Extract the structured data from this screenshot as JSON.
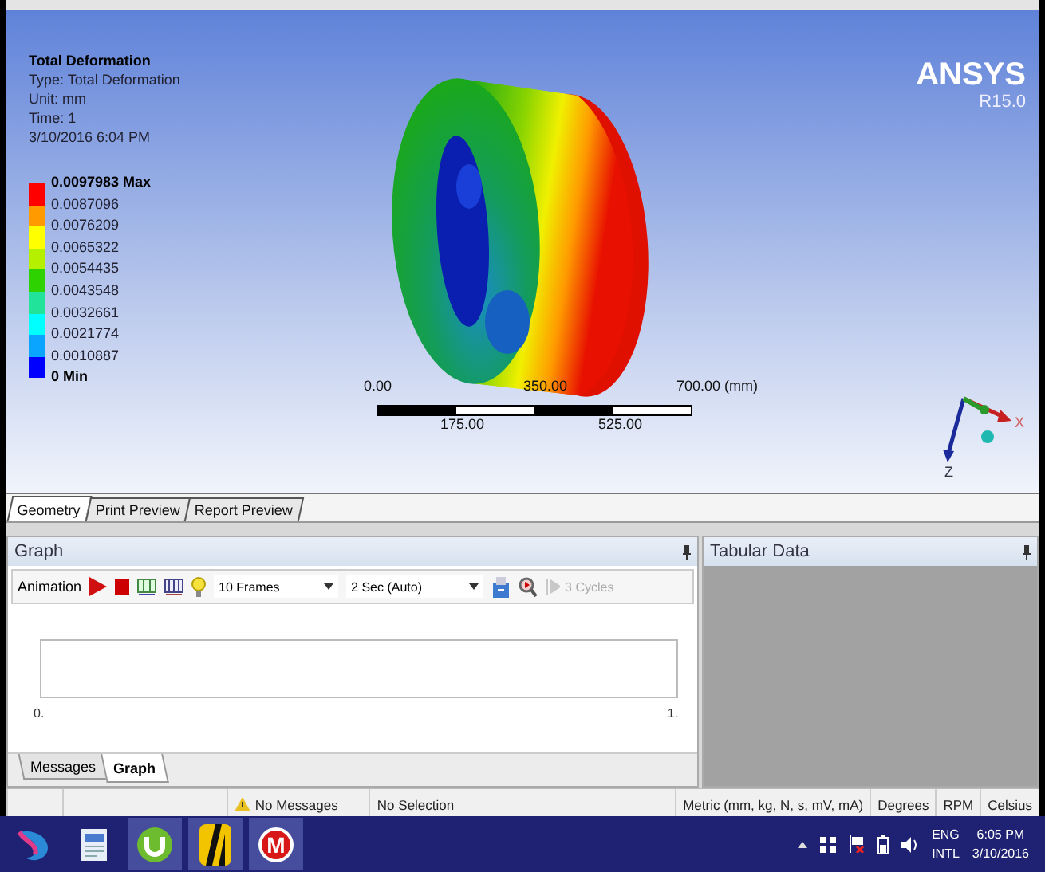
{
  "viewport": {
    "result_title": "Total Deformation",
    "details": [
      "Type: Total Deformation",
      "Unit: mm",
      "Time: 1",
      "3/10/2016 6:04 PM"
    ],
    "legend": {
      "labels": [
        {
          "text": "0.0097983 Max",
          "kind": "max"
        },
        {
          "text": "0.0087096",
          "kind": "value"
        },
        {
          "text": "0.0076209",
          "kind": "value"
        },
        {
          "text": "0.0065322",
          "kind": "value"
        },
        {
          "text": "0.0054435",
          "kind": "value"
        },
        {
          "text": "0.0043548",
          "kind": "value"
        },
        {
          "text": "0.0032661",
          "kind": "value"
        },
        {
          "text": "0.0021774",
          "kind": "value"
        },
        {
          "text": "0.0010887",
          "kind": "value"
        },
        {
          "text": "0 Min",
          "kind": "min"
        }
      ],
      "bands": [
        {
          "color": "#ff0000"
        },
        {
          "color": "#ff9a00"
        },
        {
          "color": "#ffff00"
        },
        {
          "color": "#b4f000"
        },
        {
          "color": "#2ed200"
        },
        {
          "color": "#22e39a"
        },
        {
          "color": "#00ffff"
        },
        {
          "color": "#0aa5ff"
        },
        {
          "color": "#0000ff"
        }
      ]
    },
    "logo": {
      "name": "ANSYS",
      "version": "R15.0"
    },
    "scale_bar": {
      "top_labels": [
        "0.00",
        "350.00",
        "700.00 (mm)"
      ],
      "bottom_labels": [
        "175.00",
        "525.00"
      ]
    },
    "triad": {
      "x_label": "X",
      "z_label": "Z"
    }
  },
  "view_tabs": [
    {
      "label": "Geometry",
      "selected": true
    },
    {
      "label": "Print Preview",
      "selected": false
    },
    {
      "label": "Report Preview",
      "selected": false
    }
  ],
  "graph": {
    "title": "Graph",
    "toolbar": {
      "label": "Animation",
      "frames": "10 Frames",
      "duration": "2 Sec (Auto)",
      "cycles": {
        "label": "3 Cycles",
        "disabled": true
      }
    },
    "axis_labels": [
      "0.",
      "1."
    ],
    "tabs": [
      {
        "label": "Messages",
        "selected": false
      },
      {
        "label": "Graph",
        "selected": true
      }
    ]
  },
  "tabular_data": {
    "title": "Tabular Data"
  },
  "status_bar": {
    "messages": "No Messages",
    "selection": "No Selection",
    "units": "Metric (mm, kg, N, s, mV, mA)",
    "angle": "Degrees",
    "speed": "RPM",
    "temperature": "Celsius"
  },
  "taskbar": {
    "apps": [
      {
        "kind": "swirl",
        "active": false
      },
      {
        "kind": "document",
        "active": false
      },
      {
        "kind": "torrent",
        "active": true
      },
      {
        "kind": "stripe",
        "active": true
      },
      {
        "kind": "letter",
        "glyph": "M",
        "active": true
      }
    ],
    "tray": {
      "language": "ENG",
      "layout": "INTL",
      "time": "6:05 PM",
      "date": "3/10/2016"
    }
  }
}
